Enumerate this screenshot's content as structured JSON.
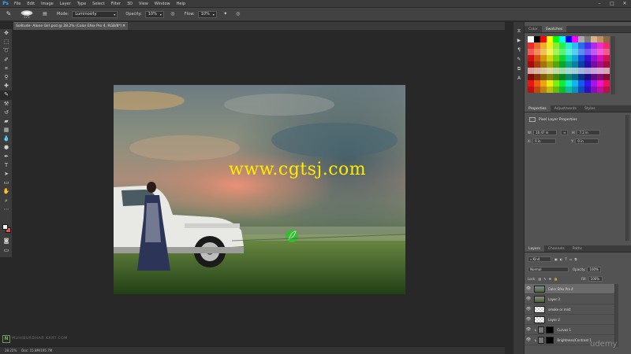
{
  "app": {
    "logo": "Ps"
  },
  "menu": [
    "File",
    "Edit",
    "Image",
    "Layer",
    "Type",
    "Select",
    "Filter",
    "3D",
    "View",
    "Window",
    "Help"
  ],
  "window_controls": [
    "–",
    "□",
    "✕"
  ],
  "options": {
    "brush_size": "175",
    "mode_label": "Mode:",
    "mode_value": "Luminosity",
    "opacity_label": "Opacity:",
    "opacity_value": "10%",
    "flow_label": "Flow:",
    "flow_value": "10%"
  },
  "document": {
    "tab_title": "Solitude- Alone Girl.psd @ 28.2% (Color Efex Pro 4, RGB/8*) *",
    "watermark": "www.cgtsj.com"
  },
  "status": {
    "zoom": "28.22%",
    "doc_info": "Doc: 15.8M/195.7M"
  },
  "overlays": {
    "site_watermark": "MUHIBURDHAR KART.COM",
    "udemy": "udemy"
  },
  "panels": {
    "color_tabs": [
      "Color",
      "Swatches"
    ],
    "properties_tabs": [
      "Properties",
      "Adjustments",
      "Styles"
    ],
    "properties_title": "Pixel Layer Properties",
    "prop_w_label": "W:",
    "prop_w_value": "10.47 in",
    "prop_h_label": "H:",
    "prop_h_value": "7.2 in",
    "prop_x_label": "X:",
    "prop_x_value": "0 in",
    "prop_y_label": "Y:",
    "prop_y_value": "0 in",
    "layers_tabs": [
      "Layers",
      "Channels",
      "Paths"
    ],
    "kind_value": "Kind",
    "blend_value": "Normal",
    "opacity_label": "Opacity:",
    "opacity_value": "100%",
    "lock_label": "Lock:",
    "fill_label": "Fill:",
    "fill_value": "100%",
    "layers": [
      {
        "name": "Color Efex Pro 4",
        "selected": true
      },
      {
        "name": "Layer 3",
        "selected": false
      },
      {
        "name": "smoke or mist",
        "selected": false
      },
      {
        "name": "Layer 2",
        "selected": false
      },
      {
        "name": "Curves 1",
        "selected": false
      },
      {
        "name": "Brightness/Contrast 1",
        "selected": false
      }
    ]
  },
  "colors": {
    "accent": "#31a8ff",
    "watermark": "#ffeb00",
    "foreground": "#f2f2f2",
    "background": "#e35454"
  }
}
